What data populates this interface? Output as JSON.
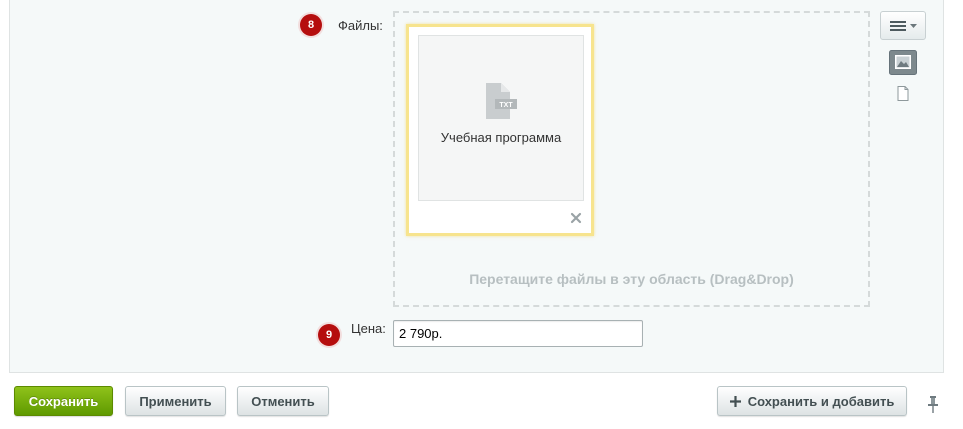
{
  "files_field": {
    "badge": "8",
    "label": "Файлы:",
    "dropzone_hint": "Перетащите файлы в эту область (Drag&Drop)",
    "file": {
      "name": "Учебная программа",
      "icon": "txt-file-icon",
      "icon_text": "TXT"
    },
    "menu_icon": "hamburger-icon",
    "view_modes": [
      "image-view-icon",
      "file-view-icon"
    ]
  },
  "price_field": {
    "badge": "9",
    "label": "Цена:",
    "value": "2 790р."
  },
  "footer": {
    "save_label": "Сохранить",
    "apply_label": "Применить",
    "cancel_label": "Отменить",
    "save_add_label": "Сохранить и добавить",
    "pin_icon": "pin-icon"
  },
  "colors": {
    "badge": "#b50e0e",
    "save_button": "#6fa80c",
    "file_card_border": "#f7e48e",
    "dropzone_hint": "#b7bfc1"
  }
}
